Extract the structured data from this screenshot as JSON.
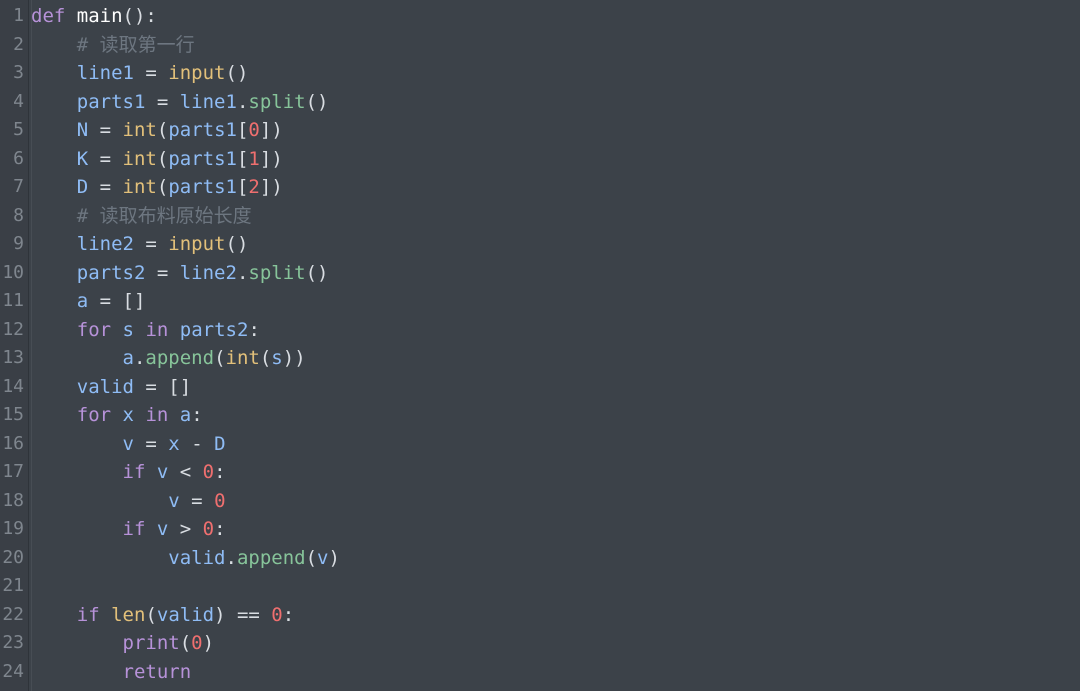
{
  "editor": {
    "lines": [
      {
        "n": "1",
        "tokens": [
          {
            "t": "kw",
            "v": "def"
          },
          {
            "t": "op",
            "v": " "
          },
          {
            "t": "name",
            "v": "main"
          },
          {
            "t": "op",
            "v": "():"
          }
        ]
      },
      {
        "n": "2",
        "tokens": [
          {
            "t": "op",
            "v": "    "
          },
          {
            "t": "cm",
            "v": "# 读取第一行"
          }
        ]
      },
      {
        "n": "3",
        "tokens": [
          {
            "t": "op",
            "v": "    "
          },
          {
            "t": "var",
            "v": "line1"
          },
          {
            "t": "op",
            "v": " = "
          },
          {
            "t": "fn",
            "v": "input"
          },
          {
            "t": "op",
            "v": "()"
          }
        ]
      },
      {
        "n": "4",
        "tokens": [
          {
            "t": "op",
            "v": "    "
          },
          {
            "t": "var",
            "v": "parts1"
          },
          {
            "t": "op",
            "v": " = "
          },
          {
            "t": "var",
            "v": "line1"
          },
          {
            "t": "op",
            "v": "."
          },
          {
            "t": "meth",
            "v": "split"
          },
          {
            "t": "op",
            "v": "()"
          }
        ]
      },
      {
        "n": "5",
        "tokens": [
          {
            "t": "op",
            "v": "    "
          },
          {
            "t": "var",
            "v": "N"
          },
          {
            "t": "op",
            "v": " = "
          },
          {
            "t": "fn",
            "v": "int"
          },
          {
            "t": "op",
            "v": "("
          },
          {
            "t": "var",
            "v": "parts1"
          },
          {
            "t": "op",
            "v": "["
          },
          {
            "t": "num",
            "v": "0"
          },
          {
            "t": "op",
            "v": "])"
          }
        ]
      },
      {
        "n": "6",
        "tokens": [
          {
            "t": "op",
            "v": "    "
          },
          {
            "t": "var",
            "v": "K"
          },
          {
            "t": "op",
            "v": " = "
          },
          {
            "t": "fn",
            "v": "int"
          },
          {
            "t": "op",
            "v": "("
          },
          {
            "t": "var",
            "v": "parts1"
          },
          {
            "t": "op",
            "v": "["
          },
          {
            "t": "num",
            "v": "1"
          },
          {
            "t": "op",
            "v": "])"
          }
        ]
      },
      {
        "n": "7",
        "tokens": [
          {
            "t": "op",
            "v": "    "
          },
          {
            "t": "var",
            "v": "D"
          },
          {
            "t": "op",
            "v": " = "
          },
          {
            "t": "fn",
            "v": "int"
          },
          {
            "t": "op",
            "v": "("
          },
          {
            "t": "var",
            "v": "parts1"
          },
          {
            "t": "op",
            "v": "["
          },
          {
            "t": "num",
            "v": "2"
          },
          {
            "t": "op",
            "v": "])"
          }
        ]
      },
      {
        "n": "8",
        "tokens": [
          {
            "t": "op",
            "v": "    "
          },
          {
            "t": "cm",
            "v": "# 读取布料原始长度"
          }
        ]
      },
      {
        "n": "9",
        "tokens": [
          {
            "t": "op",
            "v": "    "
          },
          {
            "t": "var",
            "v": "line2"
          },
          {
            "t": "op",
            "v": " = "
          },
          {
            "t": "fn",
            "v": "input"
          },
          {
            "t": "op",
            "v": "()"
          }
        ]
      },
      {
        "n": "10",
        "tokens": [
          {
            "t": "op",
            "v": "    "
          },
          {
            "t": "var",
            "v": "parts2"
          },
          {
            "t": "op",
            "v": " = "
          },
          {
            "t": "var",
            "v": "line2"
          },
          {
            "t": "op",
            "v": "."
          },
          {
            "t": "meth",
            "v": "split"
          },
          {
            "t": "op",
            "v": "()"
          }
        ]
      },
      {
        "n": "11",
        "tokens": [
          {
            "t": "op",
            "v": "    "
          },
          {
            "t": "var",
            "v": "a"
          },
          {
            "t": "op",
            "v": " = []"
          }
        ]
      },
      {
        "n": "12",
        "tokens": [
          {
            "t": "op",
            "v": "    "
          },
          {
            "t": "kw",
            "v": "for"
          },
          {
            "t": "op",
            "v": " "
          },
          {
            "t": "var",
            "v": "s"
          },
          {
            "t": "op",
            "v": " "
          },
          {
            "t": "kw",
            "v": "in"
          },
          {
            "t": "op",
            "v": " "
          },
          {
            "t": "var",
            "v": "parts2"
          },
          {
            "t": "op",
            "v": ":"
          }
        ]
      },
      {
        "n": "13",
        "tokens": [
          {
            "t": "op",
            "v": "        "
          },
          {
            "t": "var",
            "v": "a"
          },
          {
            "t": "op",
            "v": "."
          },
          {
            "t": "meth",
            "v": "append"
          },
          {
            "t": "op",
            "v": "("
          },
          {
            "t": "fn",
            "v": "int"
          },
          {
            "t": "op",
            "v": "("
          },
          {
            "t": "var",
            "v": "s"
          },
          {
            "t": "op",
            "v": "))"
          }
        ]
      },
      {
        "n": "14",
        "tokens": [
          {
            "t": "op",
            "v": "    "
          },
          {
            "t": "var",
            "v": "valid"
          },
          {
            "t": "op",
            "v": " = []"
          }
        ]
      },
      {
        "n": "15",
        "tokens": [
          {
            "t": "op",
            "v": "    "
          },
          {
            "t": "kw",
            "v": "for"
          },
          {
            "t": "op",
            "v": " "
          },
          {
            "t": "var",
            "v": "x"
          },
          {
            "t": "op",
            "v": " "
          },
          {
            "t": "kw",
            "v": "in"
          },
          {
            "t": "op",
            "v": " "
          },
          {
            "t": "var",
            "v": "a"
          },
          {
            "t": "op",
            "v": ":"
          }
        ]
      },
      {
        "n": "16",
        "tokens": [
          {
            "t": "op",
            "v": "        "
          },
          {
            "t": "var",
            "v": "v"
          },
          {
            "t": "op",
            "v": " = "
          },
          {
            "t": "var",
            "v": "x"
          },
          {
            "t": "op",
            "v": " - "
          },
          {
            "t": "var",
            "v": "D"
          }
        ]
      },
      {
        "n": "17",
        "tokens": [
          {
            "t": "op",
            "v": "        "
          },
          {
            "t": "kw",
            "v": "if"
          },
          {
            "t": "op",
            "v": " "
          },
          {
            "t": "var",
            "v": "v"
          },
          {
            "t": "op",
            "v": " < "
          },
          {
            "t": "num",
            "v": "0"
          },
          {
            "t": "op",
            "v": ":"
          }
        ]
      },
      {
        "n": "18",
        "tokens": [
          {
            "t": "op",
            "v": "            "
          },
          {
            "t": "var",
            "v": "v"
          },
          {
            "t": "op",
            "v": " = "
          },
          {
            "t": "num",
            "v": "0"
          }
        ]
      },
      {
        "n": "19",
        "tokens": [
          {
            "t": "op",
            "v": "        "
          },
          {
            "t": "kw",
            "v": "if"
          },
          {
            "t": "op",
            "v": " "
          },
          {
            "t": "var",
            "v": "v"
          },
          {
            "t": "op",
            "v": " > "
          },
          {
            "t": "num",
            "v": "0"
          },
          {
            "t": "op",
            "v": ":"
          }
        ]
      },
      {
        "n": "20",
        "tokens": [
          {
            "t": "op",
            "v": "            "
          },
          {
            "t": "var",
            "v": "valid"
          },
          {
            "t": "op",
            "v": "."
          },
          {
            "t": "meth",
            "v": "append"
          },
          {
            "t": "op",
            "v": "("
          },
          {
            "t": "var",
            "v": "v"
          },
          {
            "t": "op",
            "v": ")"
          }
        ]
      },
      {
        "n": "21",
        "tokens": []
      },
      {
        "n": "22",
        "tokens": [
          {
            "t": "op",
            "v": "    "
          },
          {
            "t": "kw",
            "v": "if"
          },
          {
            "t": "op",
            "v": " "
          },
          {
            "t": "fn",
            "v": "len"
          },
          {
            "t": "op",
            "v": "("
          },
          {
            "t": "var",
            "v": "valid"
          },
          {
            "t": "op",
            "v": ") == "
          },
          {
            "t": "num",
            "v": "0"
          },
          {
            "t": "op",
            "v": ":"
          }
        ]
      },
      {
        "n": "23",
        "tokens": [
          {
            "t": "op",
            "v": "        "
          },
          {
            "t": "kw",
            "v": "print"
          },
          {
            "t": "op",
            "v": "("
          },
          {
            "t": "num",
            "v": "0"
          },
          {
            "t": "op",
            "v": ")"
          }
        ]
      },
      {
        "n": "24",
        "tokens": [
          {
            "t": "op",
            "v": "        "
          },
          {
            "t": "kw",
            "v": "return"
          }
        ]
      }
    ]
  },
  "colors": {
    "background": "#3c4249",
    "keyword": "#b792d9",
    "function": "#e2c07a",
    "variable": "#8fbcf5",
    "method": "#87c49a",
    "number": "#ef6f6f",
    "comment": "#6d7680"
  }
}
